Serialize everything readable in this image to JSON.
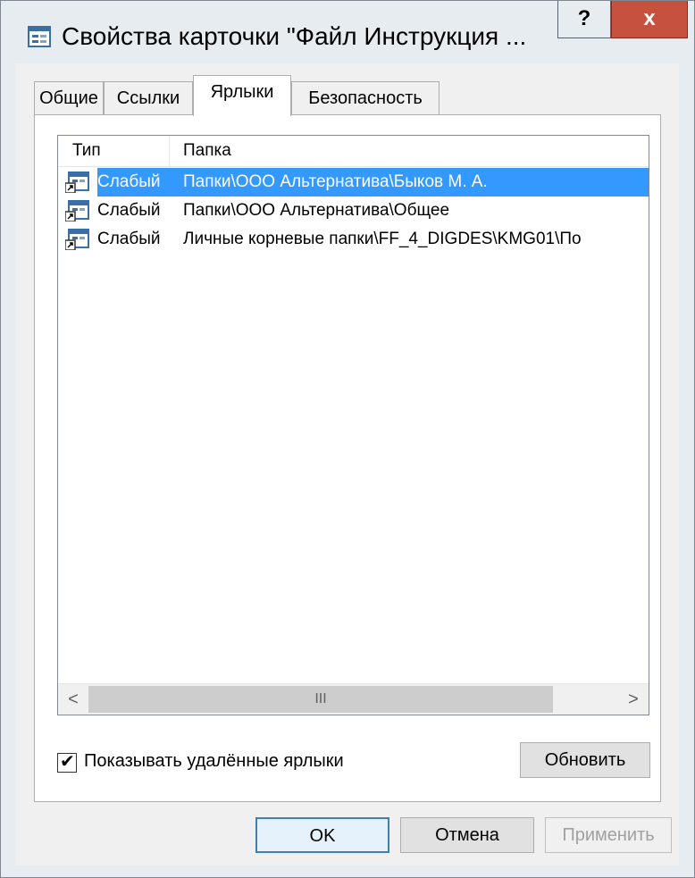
{
  "window": {
    "title": "Свойства карточки \"Файл Инструкция ...",
    "help_label": "?",
    "close_label": "x"
  },
  "tabs": [
    {
      "label": "Общие"
    },
    {
      "label": "Ссылки"
    },
    {
      "label": "Ярлыки"
    },
    {
      "label": "Безопасность"
    }
  ],
  "list": {
    "columns": {
      "type": "Тип",
      "folder": "Папка"
    },
    "rows": [
      {
        "type": "Слабый",
        "folder": "Папки\\ООО Альтернатива\\Быков М. А."
      },
      {
        "type": "Слабый",
        "folder": "Папки\\ООО Альтернатива\\Общее"
      },
      {
        "type": "Слабый",
        "folder": "Личные корневые папки\\FF_4_DIGDES\\KMG01\\По"
      }
    ],
    "scroll_left": "<",
    "scroll_right": ">",
    "scroll_thumb": "III"
  },
  "show_deleted": {
    "label": "Показывать удалённые ярлыки",
    "check": "✔"
  },
  "buttons": {
    "refresh": "Обновить",
    "ok": "OK",
    "cancel": "Отмена",
    "apply": "Применить"
  }
}
